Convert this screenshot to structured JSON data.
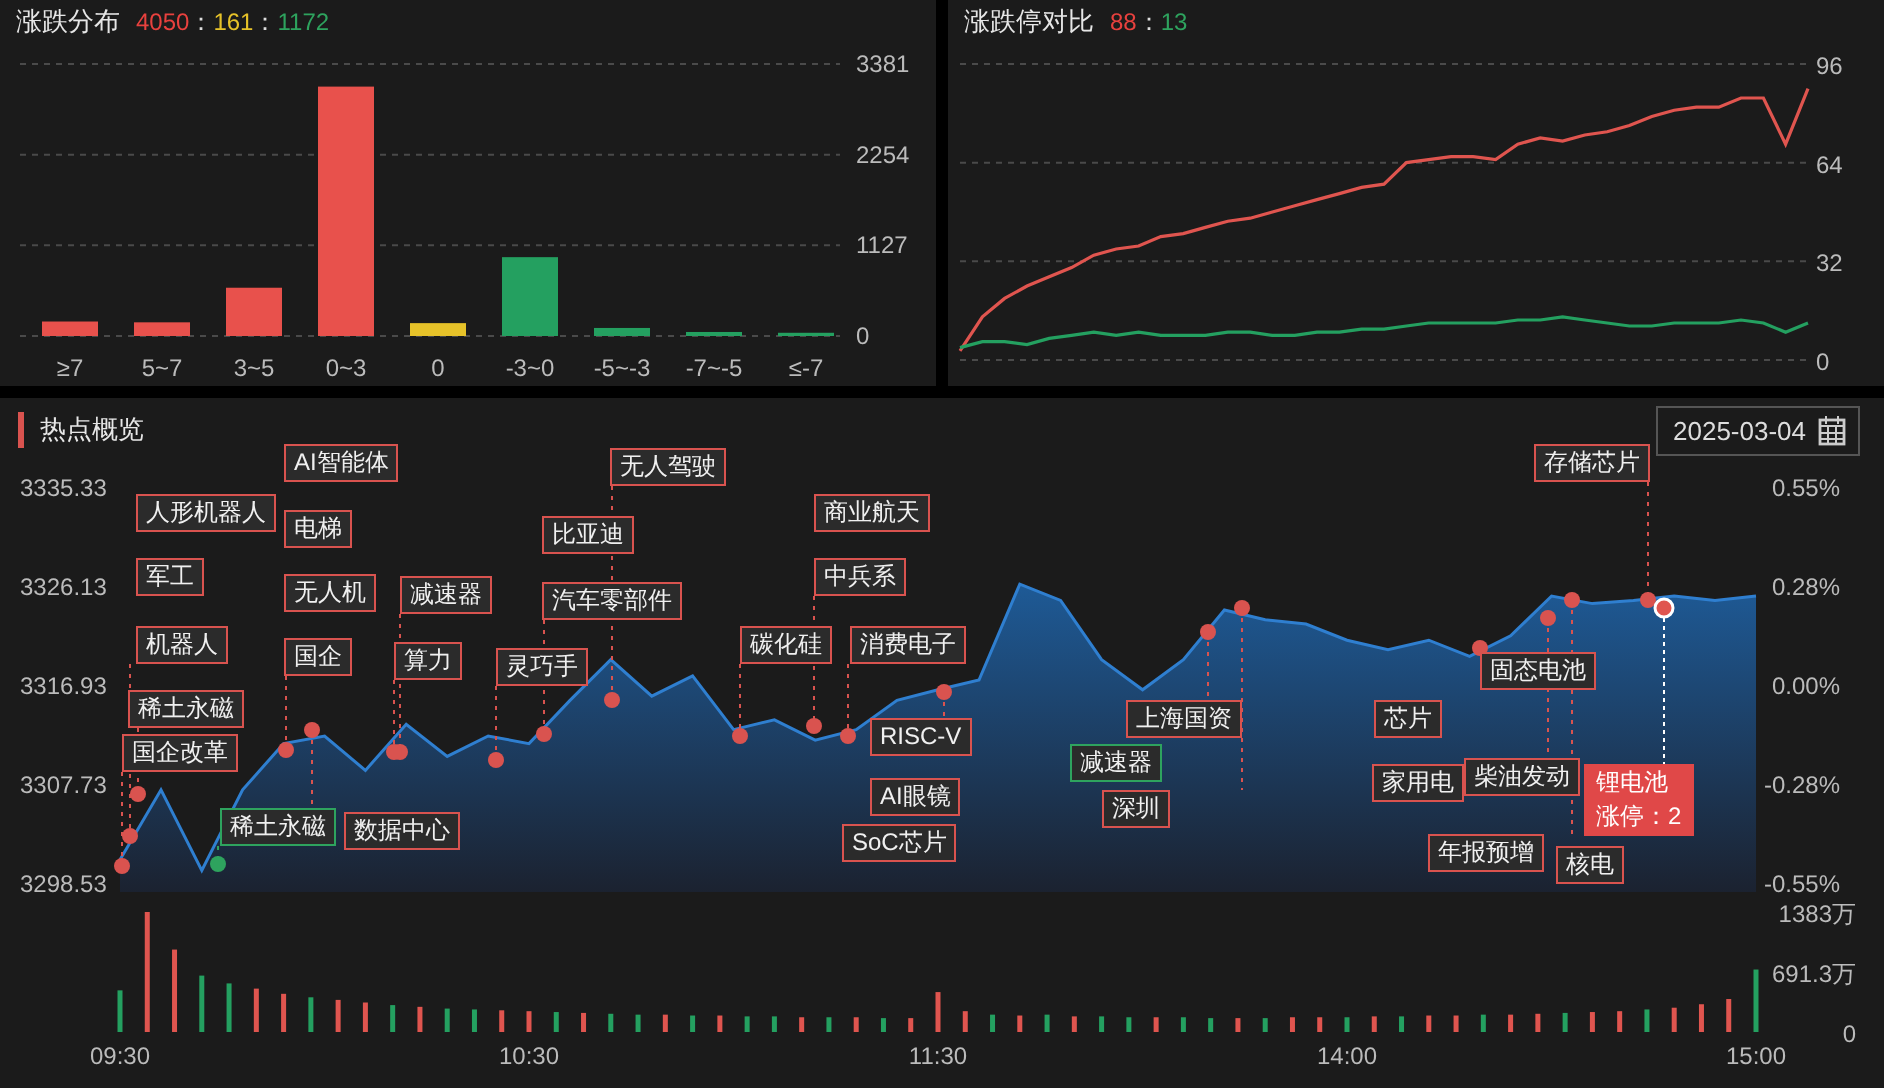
{
  "distribution": {
    "title": "涨跌分布",
    "ratio": [
      {
        "text": "4050",
        "color": "#e8413e"
      },
      {
        "text": "：",
        "color": "#dddddd"
      },
      {
        "text": "161",
        "color": "#e6c229"
      },
      {
        "text": "：",
        "color": "#dddddd"
      },
      {
        "text": "1172",
        "color": "#2ea35e"
      }
    ],
    "chart_data": {
      "type": "bar",
      "categories": [
        "≥7",
        "5~7",
        "3~5",
        "0~3",
        "0",
        "-3~0",
        "-5~-3",
        "-7~-5",
        "≤-7"
      ],
      "stacked": true,
      "ylim": [
        0,
        3381
      ],
      "yticks": [
        0,
        1127,
        2254,
        3381
      ],
      "series": [
        {
          "color": "#e8514c",
          "values": [
            180,
            170,
            600,
            3100,
            null,
            null,
            null,
            null,
            null
          ]
        },
        {
          "color": "#e6c229",
          "values": [
            null,
            null,
            null,
            null,
            160,
            null,
            null,
            null,
            null
          ]
        },
        {
          "color": "#24a060",
          "values": [
            null,
            null,
            null,
            null,
            null,
            980,
            100,
            50,
            40
          ]
        }
      ]
    }
  },
  "limit": {
    "title": "涨跌停对比",
    "ratio": [
      {
        "text": "88",
        "color": "#e8413e"
      },
      {
        "text": "：",
        "color": "#dddddd"
      },
      {
        "text": "13",
        "color": "#2ea35e"
      }
    ],
    "chart_data": {
      "type": "line",
      "ylim": [
        0,
        96
      ],
      "yticks": [
        0,
        32,
        64,
        96
      ],
      "series": [
        {
          "color": "#e0554f",
          "values": [
            3,
            14,
            20,
            24,
            27,
            30,
            34,
            36,
            37,
            40,
            41,
            43,
            45,
            46,
            48,
            50,
            52,
            54,
            56,
            57,
            64,
            65,
            66,
            66,
            65,
            70,
            72,
            71,
            73,
            74,
            76,
            79,
            81,
            82,
            82,
            85,
            85,
            70,
            88
          ]
        },
        {
          "color": "#24a060",
          "values": [
            4,
            6,
            6,
            5,
            7,
            8,
            9,
            8,
            9,
            8,
            8,
            8,
            9,
            9,
            8,
            8,
            9,
            9,
            10,
            10,
            11,
            12,
            12,
            12,
            12,
            13,
            13,
            14,
            13,
            12,
            11,
            11,
            12,
            12,
            12,
            13,
            12,
            9,
            12
          ]
        }
      ]
    }
  },
  "hotspots": {
    "title": "热点概览",
    "date": "2025-03-04",
    "price": {
      "chart_data": {
        "type": "area",
        "categories": [
          "09:30",
          null,
          null,
          null,
          null,
          null,
          null,
          null,
          null,
          null,
          "10:30",
          null,
          null,
          null,
          null,
          null,
          null,
          null,
          null,
          null,
          "11:30",
          null,
          null,
          null,
          null,
          null,
          null,
          null,
          null,
          null,
          "14:00",
          null,
          null,
          null,
          null,
          null,
          null,
          null,
          null,
          null,
          "15:00"
        ],
        "series": [
          {
            "color": "#2f7fd0",
            "values": [
              3300.6,
              3307.1,
              3299.6,
              3307.1,
              3311.4,
              3312.1,
              3308.9,
              3313.2,
              3310.2,
              3312.1,
              3311.4,
              3315.4,
              3319.2,
              3315.8,
              3317.7,
              3312.7,
              3313.6,
              3311.7,
              3312.7,
              3315.4,
              3316.4,
              3317.3,
              3326.2,
              3324.7,
              3319.2,
              3316.4,
              3319.2,
              3323.8,
              3322.9,
              3322.5,
              3321,
              3320.1,
              3321,
              3319.5,
              3321.4,
              3325.1,
              3324.4,
              3324.7,
              3325.1,
              3324.7,
              3325.1
            ]
          }
        ],
        "ylim": [
          3298.53,
          3335.33
        ],
        "yticks": [
          {
            "value": 3298.53,
            "label": "3298.53"
          },
          {
            "value": 3307.73,
            "label": "3307.73"
          },
          {
            "value": 3316.93,
            "label": "3316.93"
          },
          {
            "value": 3326.13,
            "label": "3326.13"
          },
          {
            "value": 3335.33,
            "label": "3335.33"
          }
        ]
      },
      "right_axis": [
        "0.55%",
        "0.28%",
        "0.00%",
        "-0.28%",
        "-0.55%"
      ]
    },
    "volume": {
      "chart_data": {
        "type": "bar",
        "stacked": true,
        "ylim": [
          0,
          1383
        ],
        "yticks": [
          {
            "value": 0,
            "label": "0"
          },
          {
            "value": 691.3,
            "label": "691.3万"
          },
          {
            "value": 1383,
            "label": "1383万"
          }
        ],
        "categories": [
          null,
          null,
          null,
          null,
          null,
          null,
          null,
          null,
          null,
          null,
          null,
          null,
          null,
          null,
          null,
          null,
          null,
          null,
          null,
          null,
          null,
          null,
          null,
          null,
          null,
          null,
          null,
          null,
          null,
          null,
          null,
          null,
          null,
          null,
          null,
          null,
          null,
          null,
          null,
          null,
          null,
          null,
          null,
          null,
          null,
          null,
          null,
          null,
          null,
          null,
          null,
          null,
          null,
          null,
          null,
          null,
          null,
          null,
          null,
          null,
          null
        ],
        "series": [
          {
            "color": "#e0554f",
            "values": [
              null,
              1383,
              950,
              null,
              null,
              500,
              440,
              null,
              370,
              340,
              null,
              290,
              null,
              null,
              250,
              240,
              null,
              220,
              null,
              null,
              200,
              null,
              190,
              null,
              null,
              170,
              null,
              170,
              null,
              160,
              460,
              240,
              null,
              190,
              null,
              180,
              null,
              null,
              170,
              null,
              null,
              160,
              null,
              170,
              170,
              null,
              180,
              null,
              190,
              190,
              null,
              200,
              210,
              null,
              230,
              240,
              null,
              280,
              320,
              380,
              null
            ]
          },
          {
            "color": "#24a060",
            "values": [
              480,
              null,
              null,
              650,
              560,
              null,
              null,
              400,
              null,
              null,
              310,
              null,
              270,
              260,
              null,
              null,
              230,
              null,
              210,
              200,
              null,
              190,
              null,
              180,
              180,
              null,
              170,
              null,
              160,
              null,
              null,
              null,
              200,
              null,
              200,
              null,
              180,
              170,
              null,
              170,
              160,
              null,
              160,
              null,
              null,
              170,
              null,
              180,
              null,
              null,
              200,
              null,
              null,
              220,
              null,
              null,
              260,
              null,
              null,
              null,
              720
            ]
          }
        ]
      }
    },
    "tags": [
      {
        "text": "AI智能体",
        "color": "#d9534f"
      },
      {
        "text": "无人驾驶",
        "color": "#d9534f"
      },
      {
        "text": "存储芯片",
        "color": "#d9534f"
      },
      {
        "text": "人形机器人",
        "color": "#d9534f"
      },
      {
        "text": "商业航天",
        "color": "#d9534f"
      },
      {
        "text": "电梯",
        "color": "#d9534f"
      },
      {
        "text": "比亚迪",
        "color": "#d9534f"
      },
      {
        "text": "军工",
        "color": "#d9534f"
      },
      {
        "text": "中兵系",
        "color": "#d9534f"
      },
      {
        "text": "无人机",
        "color": "#d9534f"
      },
      {
        "text": "减速器",
        "color": "#d9534f"
      },
      {
        "text": "汽车零部件",
        "color": "#d9534f"
      },
      {
        "text": "机器人",
        "color": "#d9534f"
      },
      {
        "text": "碳化硅",
        "color": "#d9534f"
      },
      {
        "text": "消费电子",
        "color": "#d9534f"
      },
      {
        "text": "国企",
        "color": "#d9534f"
      },
      {
        "text": "算力",
        "color": "#d9534f"
      },
      {
        "text": "灵巧手",
        "color": "#d9534f"
      },
      {
        "text": "固态电池",
        "color": "#d9534f"
      },
      {
        "text": "稀土永磁",
        "color": "#d9534f"
      },
      {
        "text": "上海国资",
        "color": "#d9534f"
      },
      {
        "text": "芯片",
        "color": "#d9534f"
      },
      {
        "text": "RISC-V",
        "color": "#d9534f"
      },
      {
        "text": "国企改革",
        "color": "#d9534f"
      },
      {
        "text": "减速器",
        "color": "#2ea35e"
      },
      {
        "text": "柴油发动",
        "color": "#d9534f"
      },
      {
        "text": "家用电",
        "color": "#d9534f"
      },
      {
        "text": "AI眼镜",
        "color": "#d9534f"
      },
      {
        "text": "深圳",
        "color": "#d9534f"
      },
      {
        "text": "稀土永磁",
        "color": "#2ea35e"
      },
      {
        "text": "数据中心",
        "color": "#d9534f"
      },
      {
        "text": "SoC芯片",
        "color": "#d9534f"
      },
      {
        "text": "年报预增",
        "color": "#d9534f"
      },
      {
        "text": "核电",
        "color": "#d9534f"
      }
    ],
    "tooltip": {
      "lines": [
        "锂电池",
        "涨停：2"
      ]
    }
  }
}
